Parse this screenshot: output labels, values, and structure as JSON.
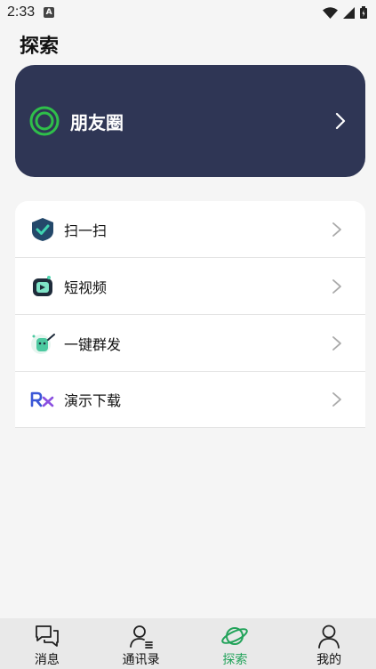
{
  "status_bar": {
    "time": "2:33",
    "notification_icon": "A"
  },
  "page": {
    "title": "探索"
  },
  "moments": {
    "label": "朋友圈",
    "icon": "ring-icon",
    "accent": "#2fbf4a",
    "background": "#2f3655"
  },
  "menu": [
    {
      "label": "扫一扫",
      "icon": "shield-check-icon"
    },
    {
      "label": "短视频",
      "icon": "video-icon"
    },
    {
      "label": "一键群发",
      "icon": "broadcast-icon"
    },
    {
      "label": "演示下载",
      "icon": "rx-logo-icon"
    }
  ],
  "tabs": [
    {
      "label": "消息",
      "icon": "chat-icon",
      "active": false
    },
    {
      "label": "通讯录",
      "icon": "contacts-icon",
      "active": false
    },
    {
      "label": "探索",
      "icon": "planet-icon",
      "active": true
    },
    {
      "label": "我的",
      "icon": "person-icon",
      "active": false
    }
  ],
  "colors": {
    "active_tab": "#22a35a",
    "tab_bar_bg": "#e9e9e9"
  }
}
